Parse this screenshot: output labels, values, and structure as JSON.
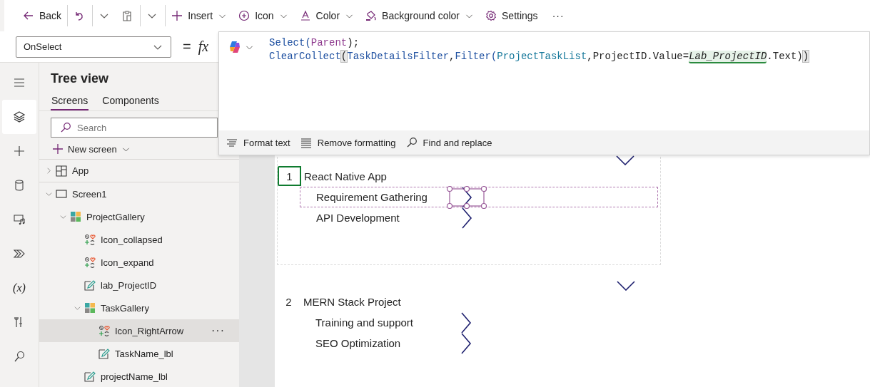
{
  "toolbar": [
    {
      "kind": "back",
      "label": "Back"
    },
    {
      "kind": "undo"
    },
    {
      "kind": "caret"
    },
    {
      "kind": "paste"
    },
    {
      "kind": "caret"
    },
    {
      "kind": "insert",
      "label": "Insert",
      "caret": true
    },
    {
      "kind": "icon",
      "label": "Icon",
      "caret": true
    },
    {
      "kind": "color",
      "label": "Color",
      "caret": true
    },
    {
      "kind": "bgcolor",
      "label": "Background color",
      "caret": true
    },
    {
      "kind": "settings",
      "label": "Settings"
    },
    {
      "kind": "more",
      "label": "···"
    }
  ],
  "formula_bar": {
    "property": "OnSelect",
    "equals": "=",
    "fx": "fx",
    "lines": [
      [
        {
          "text": "Select(",
          "kind": "fn"
        },
        {
          "text": "Parent",
          "kind": "keyword"
        },
        {
          "text": ");",
          "kind": "punct"
        }
      ],
      [
        {
          "text": "ClearCollect",
          "kind": "fn"
        },
        {
          "text": "(",
          "kind": "bracket"
        },
        {
          "text": "TaskDetailsFilter",
          "kind": "fn"
        },
        {
          "text": ",",
          "kind": "punct"
        },
        {
          "text": "Filter(",
          "kind": "fn"
        },
        {
          "text": "ProjectTaskList",
          "kind": "ident"
        },
        {
          "text": ",",
          "kind": "punct"
        },
        {
          "text": "ProjectID.Value=",
          "kind": "punct"
        },
        {
          "text": "Lab_ProjectID",
          "kind": "highlight"
        },
        {
          "text": ".Text)",
          "kind": "punct"
        },
        {
          "text": ")",
          "kind": "bracket"
        }
      ]
    ],
    "tools": [
      {
        "kind": "format",
        "label": "Format text"
      },
      {
        "kind": "remove",
        "label": "Remove formatting"
      },
      {
        "kind": "find",
        "label": "Find and replace"
      }
    ]
  },
  "rail": [
    {
      "kind": "menu",
      "selected": false
    },
    {
      "kind": "layers",
      "selected": true
    },
    {
      "kind": "plus",
      "selected": false
    },
    {
      "kind": "data",
      "selected": false
    },
    {
      "kind": "media",
      "selected": false
    },
    {
      "kind": "flow",
      "selected": false
    },
    {
      "kind": "variables",
      "label": "(x)",
      "selected": false
    },
    {
      "kind": "tools",
      "selected": false
    },
    {
      "kind": "search",
      "selected": false
    }
  ],
  "tree_view": {
    "title": "Tree view",
    "tabs": [
      {
        "label": "Screens",
        "selected": true
      },
      {
        "label": "Components",
        "selected": false
      }
    ],
    "search": {
      "placeholder": "Search"
    },
    "new_screen": "New screen",
    "items": [
      {
        "label": "App",
        "kind": "app",
        "expanded": false,
        "selected": false
      },
      {
        "label": "Screen1",
        "kind": "screen",
        "expanded": true,
        "selected": false,
        "children": [
          {
            "label": "ProjectGallery",
            "kind": "gallery",
            "expanded": true,
            "selected": false,
            "children": [
              {
                "label": "Icon_collapsed",
                "kind": "icon",
                "selected": false
              },
              {
                "label": "Icon_expand",
                "kind": "icon",
                "selected": false
              },
              {
                "label": "lab_ProjectID",
                "kind": "label",
                "selected": false
              },
              {
                "label": "TaskGallery",
                "kind": "gallery",
                "expanded": true,
                "selected": false,
                "children": [
                  {
                    "label": "Icon_RightArrow",
                    "kind": "icon",
                    "selected": true,
                    "actions": "···"
                  },
                  {
                    "label": "TaskName_lbl",
                    "kind": "label",
                    "selected": false
                  }
                ]
              },
              {
                "label": "projectName_lbl",
                "kind": "label",
                "selected": false
              }
            ]
          }
        ]
      }
    ]
  },
  "gallery": [
    {
      "number": "1",
      "name": "React Native App",
      "selected": true,
      "tasks": [
        {
          "name": "Requirement Gathering",
          "selected": true
        },
        {
          "name": "API Development",
          "selected": false
        }
      ]
    },
    {
      "number": "2",
      "name": "MERN Stack Project",
      "selected": false,
      "tasks": [
        {
          "name": "Training and support",
          "selected": false
        },
        {
          "name": "SEO Optimization",
          "selected": false
        }
      ]
    }
  ]
}
